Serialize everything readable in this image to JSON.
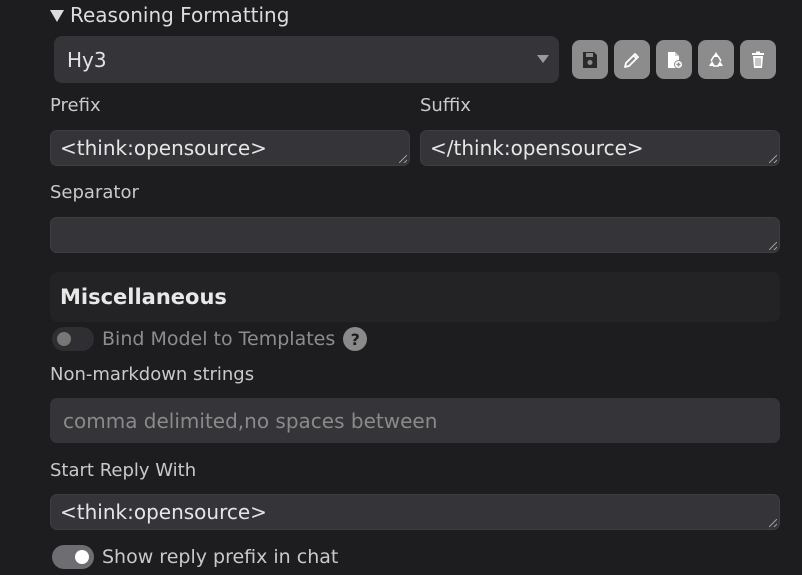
{
  "section": {
    "title": "Reasoning Formatting"
  },
  "preset": {
    "selected": "Hy3"
  },
  "icons": [
    "save-icon",
    "edit-icon",
    "new-file-icon",
    "recycle-icon",
    "trash-icon"
  ],
  "fields": {
    "prefix": {
      "label": "Prefix",
      "value": "<think:opensource>"
    },
    "suffix": {
      "label": "Suffix",
      "value": "</think:opensource>"
    },
    "separator": {
      "label": "Separator",
      "value": ""
    }
  },
  "misc": {
    "title": "Miscellaneous",
    "bind_model": {
      "label": "Bind Model to Templates",
      "help": "?"
    },
    "non_markdown": {
      "label": "Non-markdown strings",
      "placeholder": "comma delimited,no spaces between"
    },
    "start_reply": {
      "label": "Start Reply With",
      "value": "<think:opensource>"
    },
    "show_prefix": {
      "label": "Show reply prefix in chat"
    }
  },
  "colors": {
    "background": "#1d1d20",
    "field": "#353539",
    "button": "#8c8c8c"
  }
}
